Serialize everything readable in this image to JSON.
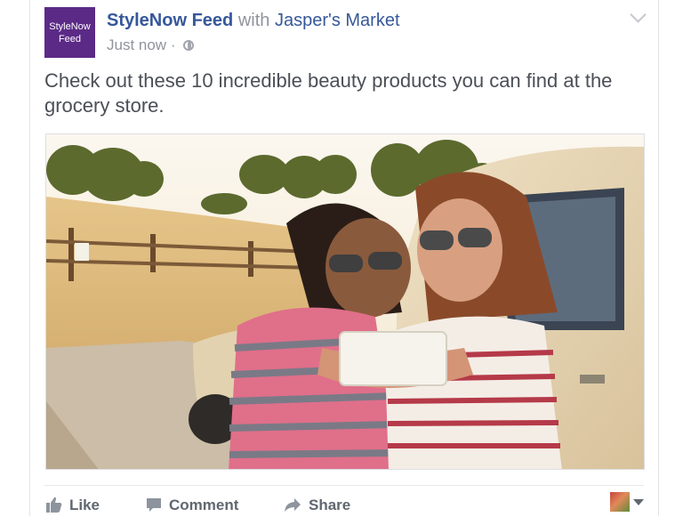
{
  "post": {
    "page_avatar_line1": "StyleNow",
    "page_avatar_line2": "Feed",
    "page_name": "StyleNow Feed",
    "with_text": "with",
    "tagged_page": "Jasper's Market",
    "timestamp": "Just now",
    "separator": "·",
    "privacy_icon": "globe-icon",
    "options_icon": "chevron-down-icon",
    "text": "Check out these 10 incredible beauty products you can find at the grocery store."
  },
  "actions": {
    "like_label": "Like",
    "comment_label": "Comment",
    "share_label": "Share"
  },
  "colors": {
    "link": "#365899",
    "secondary_text": "#90949c",
    "body_text": "#4b4f56",
    "action_text": "#606770",
    "avatar_bg": "#5b2a86"
  }
}
